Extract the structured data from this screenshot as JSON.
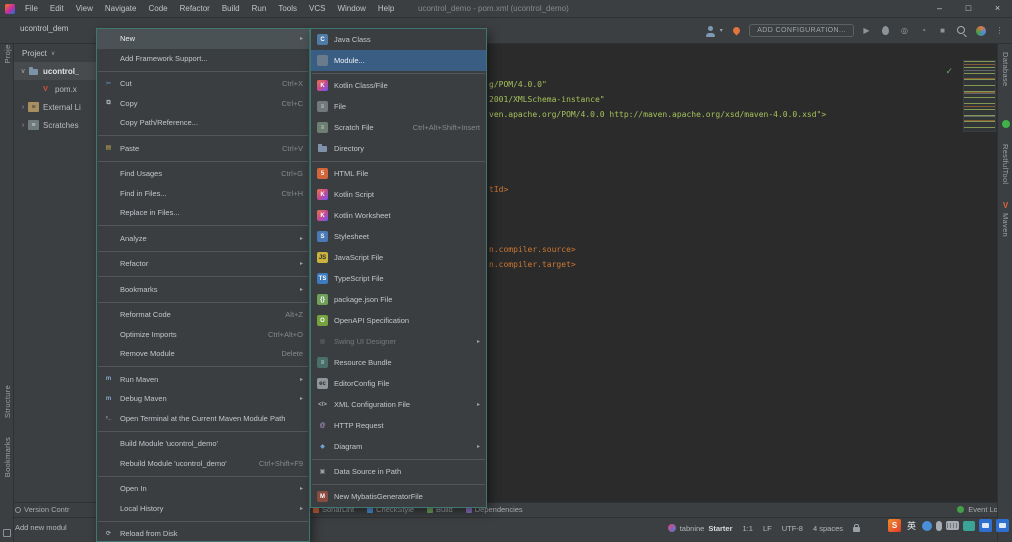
{
  "colors": {
    "panel_bg": "#3c3f41",
    "editor_bg": "#2b2b2b",
    "menu_bg": "#3b3e40",
    "menu_border": "#3f7672",
    "submenu_selection_blue": "#3a5e83",
    "parent_selection_gray": "#4b5256",
    "xml_string_green": "#a5c25c",
    "xml_tag_orange": "#cc7832",
    "event_log_green": "#43a047",
    "maven_orange": "#e0643f"
  },
  "title_bar": {
    "title": "ucontrol_demo - pom.xml (ucontrol_demo)",
    "menus": [
      {
        "name": "menubar-file",
        "label": "File"
      },
      {
        "name": "menubar-edit",
        "label": "Edit"
      },
      {
        "name": "menubar-view",
        "label": "View"
      },
      {
        "name": "menubar-navigate",
        "label": "Navigate"
      },
      {
        "name": "menubar-code",
        "label": "Code"
      },
      {
        "name": "menubar-refactor",
        "label": "Refactor"
      },
      {
        "name": "menubar-build",
        "label": "Build"
      },
      {
        "name": "menubar-run",
        "label": "Run"
      },
      {
        "name": "menubar-tools",
        "label": "Tools"
      },
      {
        "name": "menubar-vcs",
        "label": "VCS"
      },
      {
        "name": "menubar-window",
        "label": "Window"
      },
      {
        "name": "menubar-help",
        "label": "Help"
      }
    ],
    "window_buttons": [
      {
        "name": "minimize-button",
        "glyph": "–"
      },
      {
        "name": "maximize-button",
        "glyph": "□"
      },
      {
        "name": "close-button",
        "glyph": "×"
      }
    ]
  },
  "toolbar": {
    "breadcrumb": "ucontrol_dem",
    "add_configuration_label": "ADD CONFIGURATION...",
    "left_icons": [
      {
        "name": "profile-icon"
      },
      {
        "name": "caret-down-icon",
        "glyph": "▾",
        "color": "#9aa1a6"
      },
      {
        "name": "flame-icon"
      }
    ],
    "run_icons": [
      {
        "name": "run-play-icon",
        "glyph": "▶",
        "color": "#8d9499"
      },
      {
        "name": "debug-icon"
      },
      {
        "name": "coverage-icon",
        "glyph": "◎",
        "color": "#9aa1a6"
      },
      {
        "name": "profiler-icon",
        "glyph": "◔",
        "color": "#9aa1a6"
      },
      {
        "name": "stop-icon",
        "glyph": "■",
        "color": "#8d9499"
      }
    ],
    "tail_icons": [
      {
        "name": "search-everywhere-icon"
      },
      {
        "name": "ide-avatar-icon"
      },
      {
        "name": "more-options-icon",
        "glyph": "⋮",
        "color": "#9aa1a6"
      }
    ]
  },
  "left_strip": {
    "project_tab": {
      "label": "Project"
    },
    "structure_tab": {
      "label": "Structure"
    },
    "bookmarks_tab": {
      "label": "Bookmarks"
    }
  },
  "right_strip": {
    "database_tab": {
      "label": "Database"
    },
    "restful_tab": {
      "label": "RestfulTool"
    },
    "maven_tab": {
      "label": "Maven",
      "icon_glyph": "V"
    }
  },
  "project_panel": {
    "header_label": "Project",
    "header_caret": "∨",
    "tree": [
      {
        "name": "tree-item-module-root",
        "label": "ucontrol_",
        "chev": "∨",
        "icon_name": "folder-icon",
        "selected": true,
        "bold": true,
        "indent": 0
      },
      {
        "name": "tree-item-pom-xml",
        "label": "pom.x",
        "chev": "",
        "icon_name": "maven-file-icon",
        "icon_glyph": "V",
        "icon_fg": "#e0523e",
        "indent": 1
      },
      {
        "name": "tree-item-external-libraries",
        "label": "External Li",
        "chev": "›",
        "icon_name": "libraries-icon",
        "icon_glyph": "≡",
        "icon_bg": "#a98f5f",
        "icon_fg": "#3b3b3b",
        "indent": 0
      },
      {
        "name": "tree-item-scratches",
        "label": "Scratches",
        "chev": "›",
        "icon_name": "scratches-icon",
        "icon_glyph": "≡",
        "icon_bg": "#6f7a7d",
        "icon_fg": "#d0d4d6",
        "indent": 0
      }
    ]
  },
  "context_menu": {
    "items": [
      {
        "name": "menu-item-new",
        "label": "New",
        "selected": true,
        "submenu": true
      },
      {
        "name": "menu-item-add-framework-support",
        "label": "Add Framework Support..."
      },
      {
        "name": "menu-separator",
        "type": "separator"
      },
      {
        "name": "menu-item-cut",
        "label": "Cut",
        "shortcut": "Ctrl+X",
        "icon_name": "cut-icon",
        "icon_glyph": "✂",
        "icon_fg": "#6d9dd1"
      },
      {
        "name": "menu-item-copy",
        "label": "Copy",
        "shortcut": "Ctrl+C",
        "icon_name": "copy-icon",
        "icon_glyph": "⧉",
        "icon_fg": "#a9b2b8"
      },
      {
        "name": "menu-item-copy-path-reference",
        "label": "Copy Path/Reference..."
      },
      {
        "name": "menu-separator",
        "type": "separator"
      },
      {
        "name": "menu-item-paste",
        "label": "Paste",
        "shortcut": "Ctrl+V",
        "icon_name": "paste-icon",
        "icon_glyph": "▤",
        "icon_fg": "#c8aa55"
      },
      {
        "name": "menu-separator",
        "type": "separator"
      },
      {
        "name": "menu-item-find-usages",
        "label": "Find Usages",
        "shortcut": "Ctrl+G"
      },
      {
        "name": "menu-item-find-in-files",
        "label": "Find in Files...",
        "shortcut": "Ctrl+H"
      },
      {
        "name": "menu-item-replace-in-files",
        "label": "Replace in Files..."
      },
      {
        "name": "menu-separator",
        "type": "separator"
      },
      {
        "name": "menu-item-analyze",
        "label": "Analyze",
        "submenu": true
      },
      {
        "name": "menu-separator",
        "type": "separator"
      },
      {
        "name": "menu-item-refactor",
        "label": "Refactor",
        "submenu": true
      },
      {
        "name": "menu-separator",
        "type": "separator"
      },
      {
        "name": "menu-item-bookmarks",
        "label": "Bookmarks",
        "submenu": true
      },
      {
        "name": "menu-separator",
        "type": "separator"
      },
      {
        "name": "menu-item-reformat-code",
        "label": "Reformat Code",
        "shortcut": "Alt+Z"
      },
      {
        "name": "menu-item-optimize-imports",
        "label": "Optimize Imports",
        "shortcut": "Ctrl+Alt+O"
      },
      {
        "name": "menu-item-remove-module",
        "label": "Remove Module",
        "shortcut": "Delete"
      },
      {
        "name": "menu-separator",
        "type": "separator"
      },
      {
        "name": "menu-item-run-maven",
        "label": "Run Maven",
        "submenu": true,
        "icon_name": "maven-run-icon",
        "icon_glyph": "m",
        "icon_fg": "#87a9cc"
      },
      {
        "name": "menu-item-debug-maven",
        "label": "Debug Maven",
        "submenu": true,
        "icon_name": "maven-debug-icon",
        "icon_glyph": "m",
        "icon_fg": "#87a9cc"
      },
      {
        "name": "menu-item-open-terminal",
        "label": "Open Terminal at the Current Maven Module Path",
        "icon_name": "terminal-icon",
        "icon_glyph": "›_",
        "icon_fg": "#a9b2b8"
      },
      {
        "name": "menu-separator",
        "type": "separator"
      },
      {
        "name": "menu-item-build-module",
        "label": "Build Module 'ucontrol_demo'"
      },
      {
        "name": "menu-item-rebuild-module",
        "label": "Rebuild Module 'ucontrol_demo'",
        "shortcut": "Ctrl+Shift+F9"
      },
      {
        "name": "menu-separator",
        "type": "separator"
      },
      {
        "name": "menu-item-open-in",
        "label": "Open In",
        "submenu": true
      },
      {
        "name": "menu-item-local-history",
        "label": "Local History",
        "submenu": true
      },
      {
        "name": "menu-separator",
        "type": "separator"
      },
      {
        "name": "menu-item-reload-from-disk",
        "label": "Reload from Disk",
        "icon_name": "reload-icon",
        "icon_glyph": "⟳",
        "icon_fg": "#a9b2b8"
      }
    ]
  },
  "new_submenu": {
    "items": [
      {
        "name": "menu-item-java-class",
        "label": "Java Class",
        "icon_name": "java-class-icon",
        "icon_glyph": "C",
        "icon_bg": "#4e7ca6",
        "icon_fg": "#ffffff",
        "icon_shape": "circle"
      },
      {
        "name": "menu-item-module",
        "label": "Module...",
        "selected": true,
        "icon_name": "module-icon",
        "icon_glyph": "",
        "icon_bg": "#6a7b8c"
      },
      {
        "name": "menu-separator",
        "type": "separator"
      },
      {
        "name": "menu-item-kotlin-class-file",
        "label": "Kotlin Class/File",
        "icon_name": "kotlin-icon",
        "icon_glyph": "K",
        "icon_bg": "linear-gradient(135deg,#e8734c,#c94a8c,#6b57ff)",
        "icon_fg": "#ffffff"
      },
      {
        "name": "menu-item-file",
        "label": "File",
        "icon_name": "file-icon",
        "icon_glyph": "≡",
        "icon_bg": "#72787c",
        "icon_fg": "#d6d9db"
      },
      {
        "name": "menu-item-scratch-file",
        "label": "Scratch File",
        "shortcut": "Ctrl+Alt+Shift+Insert",
        "icon_name": "scratch-file-icon",
        "icon_glyph": "≡",
        "icon_bg": "#6d7f72",
        "icon_fg": "#d6d9db"
      },
      {
        "name": "menu-item-directory",
        "label": "Directory",
        "icon_name": "directory-icon",
        "icon_glyph": ""
      },
      {
        "name": "menu-separator",
        "type": "separator"
      },
      {
        "name": "menu-item-html-file",
        "label": "HTML File",
        "icon_name": "html-file-icon",
        "icon_glyph": "5",
        "icon_bg": "#d2653a",
        "icon_fg": "#ffffff"
      },
      {
        "name": "menu-item-kotlin-script",
        "label": "Kotlin Script",
        "icon_name": "kotlin-icon",
        "icon_glyph": "K",
        "icon_bg": "linear-gradient(135deg,#e8734c,#c94a8c,#6b57ff)",
        "icon_fg": "#ffffff"
      },
      {
        "name": "menu-item-kotlin-worksheet",
        "label": "Kotlin Worksheet",
        "icon_name": "kotlin-icon",
        "icon_glyph": "K",
        "icon_bg": "linear-gradient(135deg,#e8734c,#c94a8c,#6b57ff)",
        "icon_fg": "#ffffff"
      },
      {
        "name": "menu-item-stylesheet",
        "label": "Stylesheet",
        "icon_name": "stylesheet-icon",
        "icon_glyph": "S",
        "icon_bg": "#4a7ab5",
        "icon_fg": "#ffffff"
      },
      {
        "name": "menu-item-javascript-file",
        "label": "JavaScript File",
        "icon_name": "javascript-file-icon",
        "icon_glyph": "JS",
        "icon_bg": "#c9b33c",
        "icon_fg": "#2b2b2b"
      },
      {
        "name": "menu-item-typescript-file",
        "label": "TypeScript File",
        "icon_name": "typescript-file-icon",
        "icon_glyph": "TS",
        "icon_bg": "#3d7ac0",
        "icon_fg": "#ffffff"
      },
      {
        "name": "menu-item-package-json-file",
        "label": "package.json File",
        "icon_name": "package-json-icon",
        "icon_glyph": "{}",
        "icon_bg": "#6fa05a",
        "icon_fg": "#ffffff"
      },
      {
        "name": "menu-item-openapi-specification",
        "label": "OpenAPI Specification",
        "icon_name": "openapi-icon",
        "icon_glyph": "O",
        "icon_bg": "#74a33f",
        "icon_fg": "#ffffff",
        "icon_shape": "circle"
      },
      {
        "name": "menu-item-swing-ui-designer",
        "label": "Swing UI Designer",
        "enabled": false,
        "submenu": true,
        "icon_name": "swing-designer-icon",
        "icon_glyph": "▦",
        "icon_fg": "#7a8084"
      },
      {
        "name": "menu-item-resource-bundle",
        "label": "Resource Bundle",
        "icon_name": "resource-bundle-icon",
        "icon_glyph": "≡",
        "icon_bg": "#4a6e6a",
        "icon_fg": "#cfe8e4"
      },
      {
        "name": "menu-item-editorconfig-file",
        "label": "EditorConfig File",
        "icon_name": "editorconfig-icon",
        "icon_glyph": "ec",
        "icon_bg": "#90969a",
        "icon_fg": "#2b2b2b",
        "icon_shape": "circle"
      },
      {
        "name": "menu-item-xml-configuration-file",
        "label": "XML Configuration File",
        "submenu": true,
        "icon_name": "xml-file-icon",
        "icon_glyph": "</>",
        "icon_fg": "#b0b6ba"
      },
      {
        "name": "menu-item-http-request",
        "label": "HTTP Request",
        "icon_name": "http-request-icon",
        "icon_glyph": "@",
        "icon_fg": "#b79ad1"
      },
      {
        "name": "menu-item-diagram",
        "label": "Diagram",
        "submenu": true,
        "icon_name": "diagram-icon",
        "icon_glyph": "◆",
        "icon_fg": "#6fa3d8"
      },
      {
        "name": "menu-separator",
        "type": "separator"
      },
      {
        "name": "menu-item-data-source-in-path",
        "label": "Data Source in Path",
        "icon_name": "data-source-icon",
        "icon_glyph": "▣",
        "icon_fg": "#9aa1a6"
      },
      {
        "name": "menu-separator",
        "type": "separator"
      },
      {
        "name": "menu-item-new-mybatis-generator-file",
        "label": "New MybatisGeneratorFile",
        "icon_name": "mybatis-icon",
        "icon_glyph": "M",
        "icon_bg": "#8a4c3f",
        "icon_fg": "#ffffff"
      }
    ]
  },
  "editor": {
    "code_lines": [
      {
        "text": "g/POM/4.0.0\"",
        "color": "#a5c25c"
      },
      {
        "text": "2001/XMLSchema-instance\"",
        "color": "#a5c25c"
      },
      {
        "text": "ven.apache.org/POM/4.0.0 http://maven.apache.org/xsd/maven-4.0.0.xsd\">",
        "color": "#a5c25c"
      },
      {
        "text": ""
      },
      {
        "text": ""
      },
      {
        "text": ""
      },
      {
        "text": ""
      },
      {
        "text": "tId>",
        "color": "#cc7832"
      },
      {
        "text": ""
      },
      {
        "text": ""
      },
      {
        "text": ""
      },
      {
        "text": "n.compiler.source>",
        "color": "#cc7832"
      },
      {
        "text": "n.compiler.target>",
        "color": "#cc7832"
      }
    ]
  },
  "bottom_tool_bar": {
    "version_control_label": "Version Contr",
    "tabs": [
      {
        "name": "tool-tab-sonarlint",
        "label": "SonarLint"
      },
      {
        "name": "tool-tab-checkstyle",
        "label": "CheckStyle"
      },
      {
        "name": "tool-tab-build",
        "label": "Build"
      },
      {
        "name": "tool-tab-dependencies",
        "label": "Dependencies"
      }
    ],
    "event_log_label": "Event Log"
  },
  "status_bar": {
    "message": "Add new modul",
    "tabnine_label": "tabnine",
    "tabnine_plan": "Starter",
    "segments": [
      {
        "name": "status-caret-position",
        "label": "1:1"
      },
      {
        "name": "status-line-ending",
        "label": "LF"
      },
      {
        "name": "status-encoding",
        "label": "UTF-8"
      },
      {
        "name": "status-indent",
        "label": "4 spaces"
      }
    ]
  },
  "taskbar": {
    "icons": [
      {
        "name": "sogou-input-icon",
        "glyph": "S"
      },
      {
        "name": "language-mode-icon",
        "glyph": "英"
      },
      {
        "name": "input-emoji-icon"
      },
      {
        "name": "input-mic-icon"
      },
      {
        "name": "input-keyboard-icon"
      },
      {
        "name": "screenshot-tool-icon"
      },
      {
        "name": "tray-window-icon-1"
      },
      {
        "name": "tray-window-icon-2"
      }
    ]
  }
}
